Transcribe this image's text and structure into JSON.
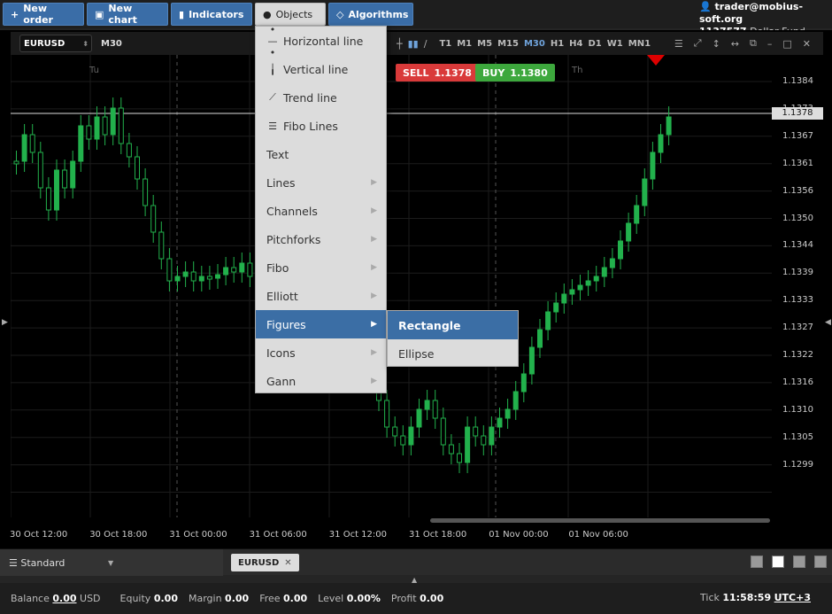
{
  "toolbar": {
    "new_order": "New order",
    "new_chart": "New chart",
    "indicators": "Indicators",
    "objects": "Objects",
    "algorithms": "Algorithms"
  },
  "account": {
    "user": "trader@mobius-soft.org",
    "id": "1137577",
    "fund": "Dollar Fund"
  },
  "chart": {
    "symbol": "EURUSD",
    "timeframe": "M30",
    "timeframes": [
      "T1",
      "M1",
      "M5",
      "M15",
      "M30",
      "H1",
      "H4",
      "D1",
      "W1",
      "MN1"
    ],
    "selected_timeframe": "M30",
    "sell_label": "SELL",
    "sell_price": "1.1378",
    "buy_label": "BUY",
    "buy_price": "1.1380",
    "current_price": "1.1378",
    "day_labels": [
      "Tu",
      "Th"
    ],
    "price_labels": [
      "1.1384",
      "1.1373",
      "1.1367",
      "1.1361",
      "1.1356",
      "1.1350",
      "1.1344",
      "1.1339",
      "1.1333",
      "1.1327",
      "1.1322",
      "1.1316",
      "1.1310",
      "1.1305",
      "1.1299"
    ],
    "time_labels": [
      "30 Oct 12:00",
      "30 Oct 18:00",
      "31 Oct 00:00",
      "31 Oct 06:00",
      "31 Oct 12:00",
      "31 Oct 18:00",
      "01 Nov 00:00",
      "01 Nov 06:00"
    ]
  },
  "objects_menu": {
    "items": [
      {
        "label": "Horizontal line",
        "icon": "horizontal-line-icon",
        "submenu": false
      },
      {
        "label": "Vertical line",
        "icon": "vertical-line-icon",
        "submenu": false
      },
      {
        "label": "Trend line",
        "icon": "trend-line-icon",
        "submenu": false
      },
      {
        "label": "Fibo Lines",
        "icon": "fibo-lines-icon",
        "submenu": false
      },
      {
        "label": "Text",
        "icon": "",
        "submenu": false
      },
      {
        "label": "Lines",
        "icon": "",
        "submenu": true
      },
      {
        "label": "Channels",
        "icon": "",
        "submenu": true
      },
      {
        "label": "Pitchforks",
        "icon": "",
        "submenu": true
      },
      {
        "label": "Fibo",
        "icon": "",
        "submenu": true
      },
      {
        "label": "Elliott",
        "icon": "",
        "submenu": true
      },
      {
        "label": "Figures",
        "icon": "",
        "submenu": true,
        "highlighted": true
      },
      {
        "label": "Icons",
        "icon": "",
        "submenu": true
      },
      {
        "label": "Gann",
        "icon": "",
        "submenu": true
      }
    ],
    "figures_submenu": [
      "Rectangle",
      "Ellipse"
    ]
  },
  "bottom": {
    "layout": "Standard",
    "tab": "EURUSD"
  },
  "status": {
    "balance_label": "Balance",
    "balance": "0.00",
    "currency": "USD",
    "equity_label": "Equity",
    "equity": "0.00",
    "margin_label": "Margin",
    "margin": "0.00",
    "free_label": "Free",
    "free": "0.00",
    "level_label": "Level",
    "level": "0.00%",
    "profit_label": "Profit",
    "profit": "0.00",
    "tick_label": "Tick",
    "time": "11:58:59",
    "tz": "UTC+3"
  },
  "colors": {
    "accent": "#3b6ea5",
    "candle": "#22b14c",
    "sell": "#d93a3a",
    "buy": "#3da83d"
  }
}
